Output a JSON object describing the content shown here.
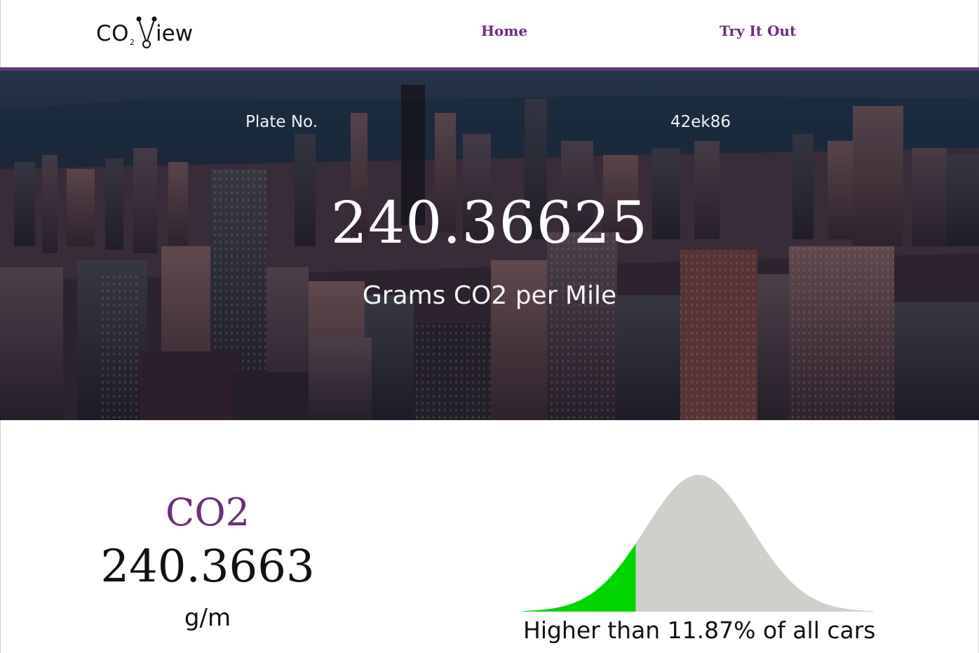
{
  "header": {
    "logo": {
      "part1": "CO",
      "subscript": "2",
      "part2": "iew"
    },
    "nav": [
      {
        "label": "Home"
      },
      {
        "label": "Try It Out"
      }
    ]
  },
  "hero": {
    "plate_label": "Plate No.",
    "plate_value": "42ek86",
    "emission_value": "240.36625",
    "emission_unit": "Grams CO2 per Mile"
  },
  "summary": {
    "title": "CO2",
    "value": "240.3663",
    "unit": "g/m",
    "comparison_text": "Higher than 11.87% of all cars",
    "percentile": 11.87
  },
  "colors": {
    "accent_purple": "#6b2f7c",
    "percentile_fill": "#00d500",
    "distribution_fill": "#d0d0cb"
  },
  "icons": {
    "logo_mark": "molecule-v-icon"
  }
}
